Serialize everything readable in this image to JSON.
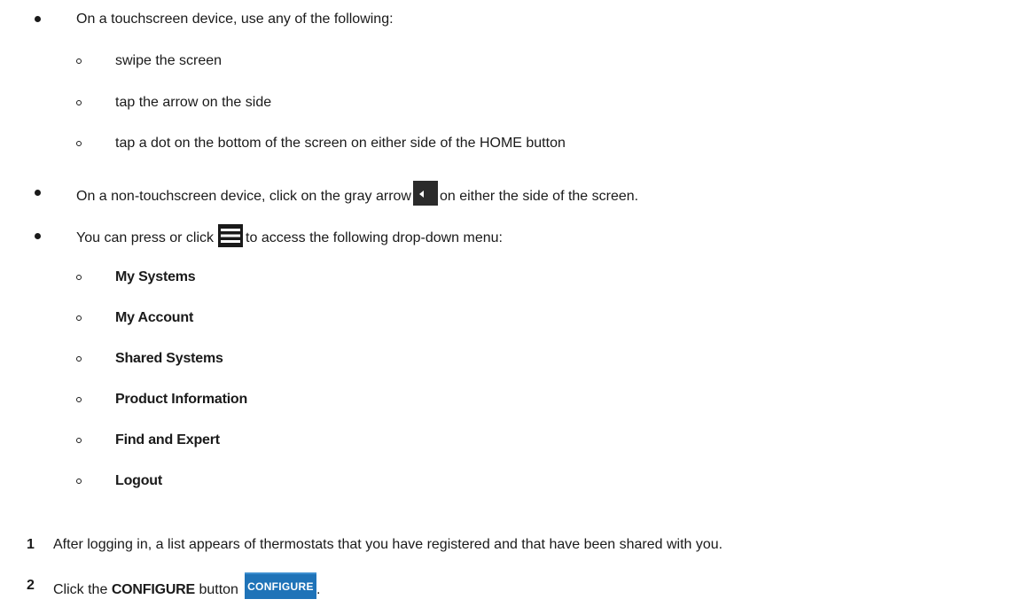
{
  "touchscreen": {
    "intro": "On a touchscreen device, use any of the following:",
    "options": [
      "swipe the screen",
      "tap the arrow on the side",
      "tap a dot on the bottom of the screen on either side of the HOME button"
    ]
  },
  "non_touch": {
    "before": "On a non-touchscreen device, click on the gray arrow",
    "after": "on either the side of the screen.",
    "icon": "left-arrow-icon"
  },
  "menu": {
    "before": "You can press or click",
    "after": "to access the following drop-down menu:",
    "icon": "hamburger-menu-icon",
    "items": [
      "My Systems",
      "My Account",
      "Shared Systems",
      "Product Information",
      "Find and Expert",
      "Logout"
    ]
  },
  "steps": [
    {
      "number": "1",
      "text": "After logging in, a list appears of thermostats that you have registered and that have been shared with you."
    },
    {
      "number": "2",
      "text_before": "Click the",
      "bold": "CONFIGURE",
      "text_after": "button",
      "button_label": "CONFIGURE",
      "end": "."
    }
  ],
  "colors": {
    "configure_button": "#1f73b8",
    "arrow_icon_bg": "#2b2b2b"
  }
}
